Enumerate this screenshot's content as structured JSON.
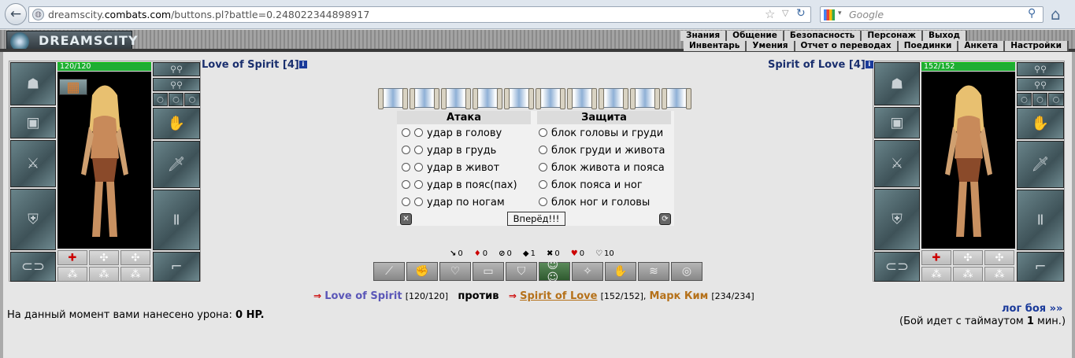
{
  "browser": {
    "url_prefix": "dreamscity.",
    "url_domain": "combats.com",
    "url_path": "/buttons.pl?battle=0.248022344898917",
    "search_placeholder": "Google"
  },
  "header": {
    "logo_text": "DREAMSCITY",
    "menu_top": [
      "Знания",
      "Общение",
      "Безопасность",
      "Персонаж",
      "Выход"
    ],
    "menu_bottom": [
      "Инвентарь",
      "Умения",
      "Отчет о переводах",
      "Поединки",
      "Анкета",
      "Настройки"
    ]
  },
  "left_player": {
    "name": "Love of Spirit [4]",
    "hp_text": "120/120",
    "hp_fraction": 1.0
  },
  "right_player": {
    "name": "Spirit of Love [4]",
    "hp_text": "152/152",
    "hp_fraction": 1.0
  },
  "info_icon": "i",
  "attack": {
    "title": "Атака",
    "options": [
      "удар в голову",
      "удар в грудь",
      "удар в живот",
      "удар в пояс(пах)",
      "удар по ногам"
    ]
  },
  "defense": {
    "title": "Защита",
    "options": [
      "блок головы и груди",
      "блок груди и живота",
      "блок живота и пояса",
      "блок пояса и ног",
      "блок ног и головы"
    ]
  },
  "go_button": "Вперёд!!!",
  "stats": [
    {
      "icon": "sword-icon",
      "glyph": "↘",
      "value": "0"
    },
    {
      "icon": "blood-icon",
      "glyph": "♦",
      "value": "0"
    },
    {
      "icon": "counter-icon",
      "glyph": "⊘",
      "value": "0"
    },
    {
      "icon": "shield-icon",
      "glyph": "◆",
      "value": "1"
    },
    {
      "icon": "parry-icon",
      "glyph": "✖",
      "value": "0"
    },
    {
      "icon": "heart-icon",
      "glyph": "♥",
      "value": "0"
    },
    {
      "icon": "spirit-icon",
      "glyph": "♡",
      "value": "10"
    }
  ],
  "versus": {
    "player": "Love of Spirit",
    "player_hp": "[120/120]",
    "vs_word": "против",
    "enemy1": "Spirit of Love",
    "enemy1_hp": "[152/152],",
    "enemy2": "Марк Ким",
    "enemy2_hp": "[234/234]"
  },
  "damage": {
    "prefix": "На данный момент вами нанесено урона: ",
    "value": "0 HP."
  },
  "log_link": "лог боя »»",
  "timeout": {
    "prefix": "(Бой идет с таймаутом ",
    "value": "1",
    "suffix": " мин.)"
  }
}
